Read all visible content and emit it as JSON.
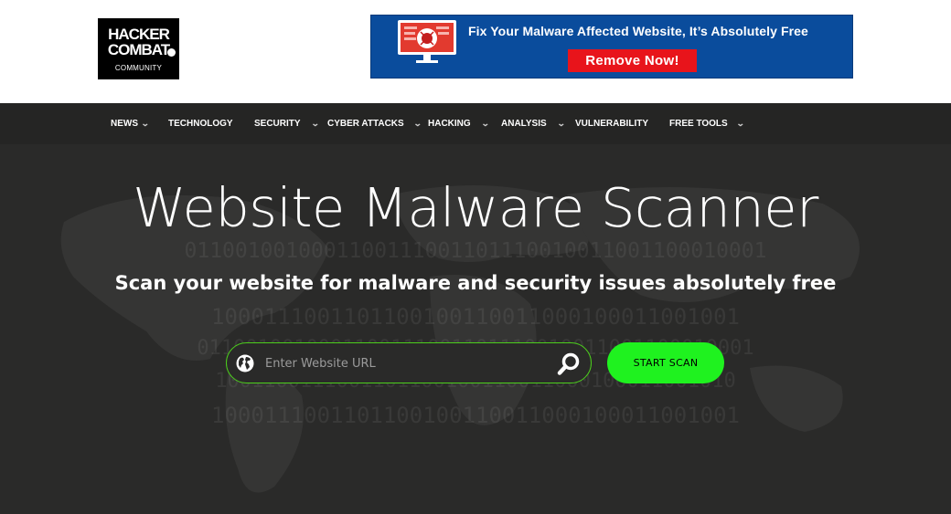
{
  "logo": {
    "line1": "HACKER",
    "line2": "COMBAT",
    "line3": "COMMUNITY"
  },
  "banner": {
    "headline": "Fix Your Malware Affected Website, It’s Absolutely Free",
    "button": "Remove Now!"
  },
  "nav": {
    "items": [
      {
        "label": "NEWS",
        "dropdown": true
      },
      {
        "label": "TECHNOLOGY",
        "dropdown": false
      },
      {
        "label": "SECURITY",
        "dropdown": true
      },
      {
        "label": "CYBER ATTACKS",
        "dropdown": true
      },
      {
        "label": "HACKING",
        "dropdown": true
      },
      {
        "label": "ANALYSIS",
        "dropdown": true
      },
      {
        "label": "VULNERABILITY",
        "dropdown": false
      },
      {
        "label": "FREE TOOLS",
        "dropdown": true
      }
    ],
    "chevron": "chevron-down-icon"
  },
  "hero": {
    "title": "Website Malware Scanner",
    "subtitle": "Scan your website for malware and security issues absolutely free",
    "binary_rows": [
      "0110010010001100111001101110010011001100010001",
      "1000111001101100100110011000100011001001",
      "0110010010001100111001101110010011001100010001",
      "1001100111001101100100110011000100011001010",
      "1000111001101100100110011000100011001001"
    ]
  },
  "search": {
    "placeholder": "Enter Website URL",
    "value": "",
    "button": "START SCAN"
  },
  "colors": {
    "accent_green": "#1ff21f",
    "input_border": "#4ccf1c",
    "hero_bg": "#2a2a29",
    "nav_bg": "#252524",
    "banner_bg": "#0a4c9c",
    "banner_button": "#e8141b"
  },
  "icons": {
    "search_field_left": "globe-icon",
    "search_field_right": "search-icon"
  }
}
